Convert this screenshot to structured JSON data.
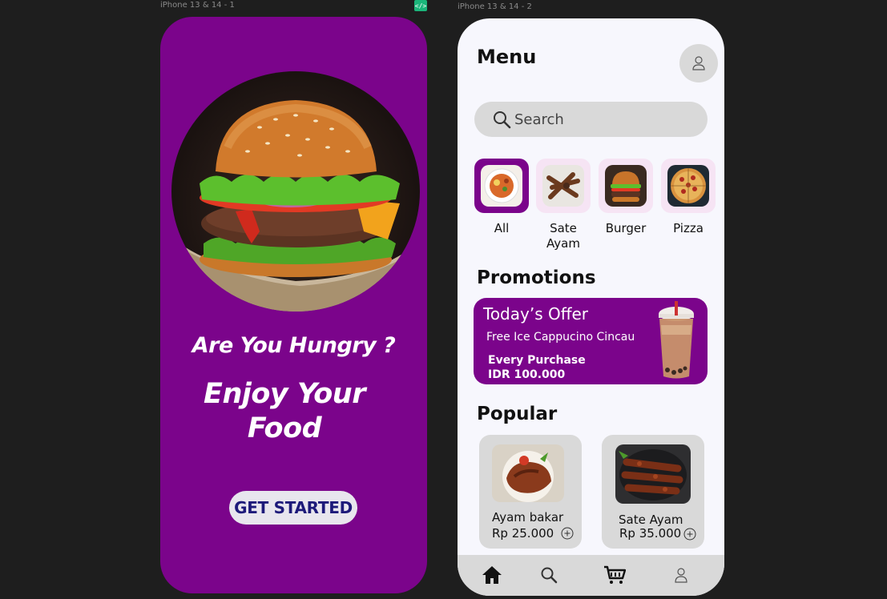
{
  "canvas": {
    "frame1_label": "iPhone 13 & 14 - 1",
    "frame2_label": "iPhone 13 & 14 - 2",
    "code_badge": "</>"
  },
  "welcome": {
    "headline": "Are You Hungry ?",
    "tagline_line1": "Enjoy Your",
    "tagline_line2": "Food",
    "cta_label": "GET STARTED",
    "brand_color": "#7b048b"
  },
  "menu": {
    "title": "Menu",
    "search_placeholder": "Search",
    "categories": [
      {
        "label": "All",
        "icon": "noodle-bowl",
        "active": true
      },
      {
        "label": "Sate Ayam",
        "icon": "satay",
        "active": false
      },
      {
        "label": "Burger",
        "icon": "burger",
        "active": false
      },
      {
        "label": "Pizza",
        "icon": "pizza",
        "active": false
      }
    ],
    "promotions_title": "Promotions",
    "promo": {
      "title": "Today’s Offer",
      "subtitle": "Free Ice Cappucino Cincau",
      "condition_line1": "Every Purchase",
      "condition_line2": "IDR 100.000"
    },
    "popular_title": "Popular",
    "popular": [
      {
        "name": "Ayam bakar",
        "price": "Rp 25.000"
      },
      {
        "name": "Sate Ayam",
        "price": "Rp 35.000"
      }
    ],
    "nav": [
      "home-icon",
      "search-icon",
      "cart-icon",
      "profile-icon"
    ]
  }
}
